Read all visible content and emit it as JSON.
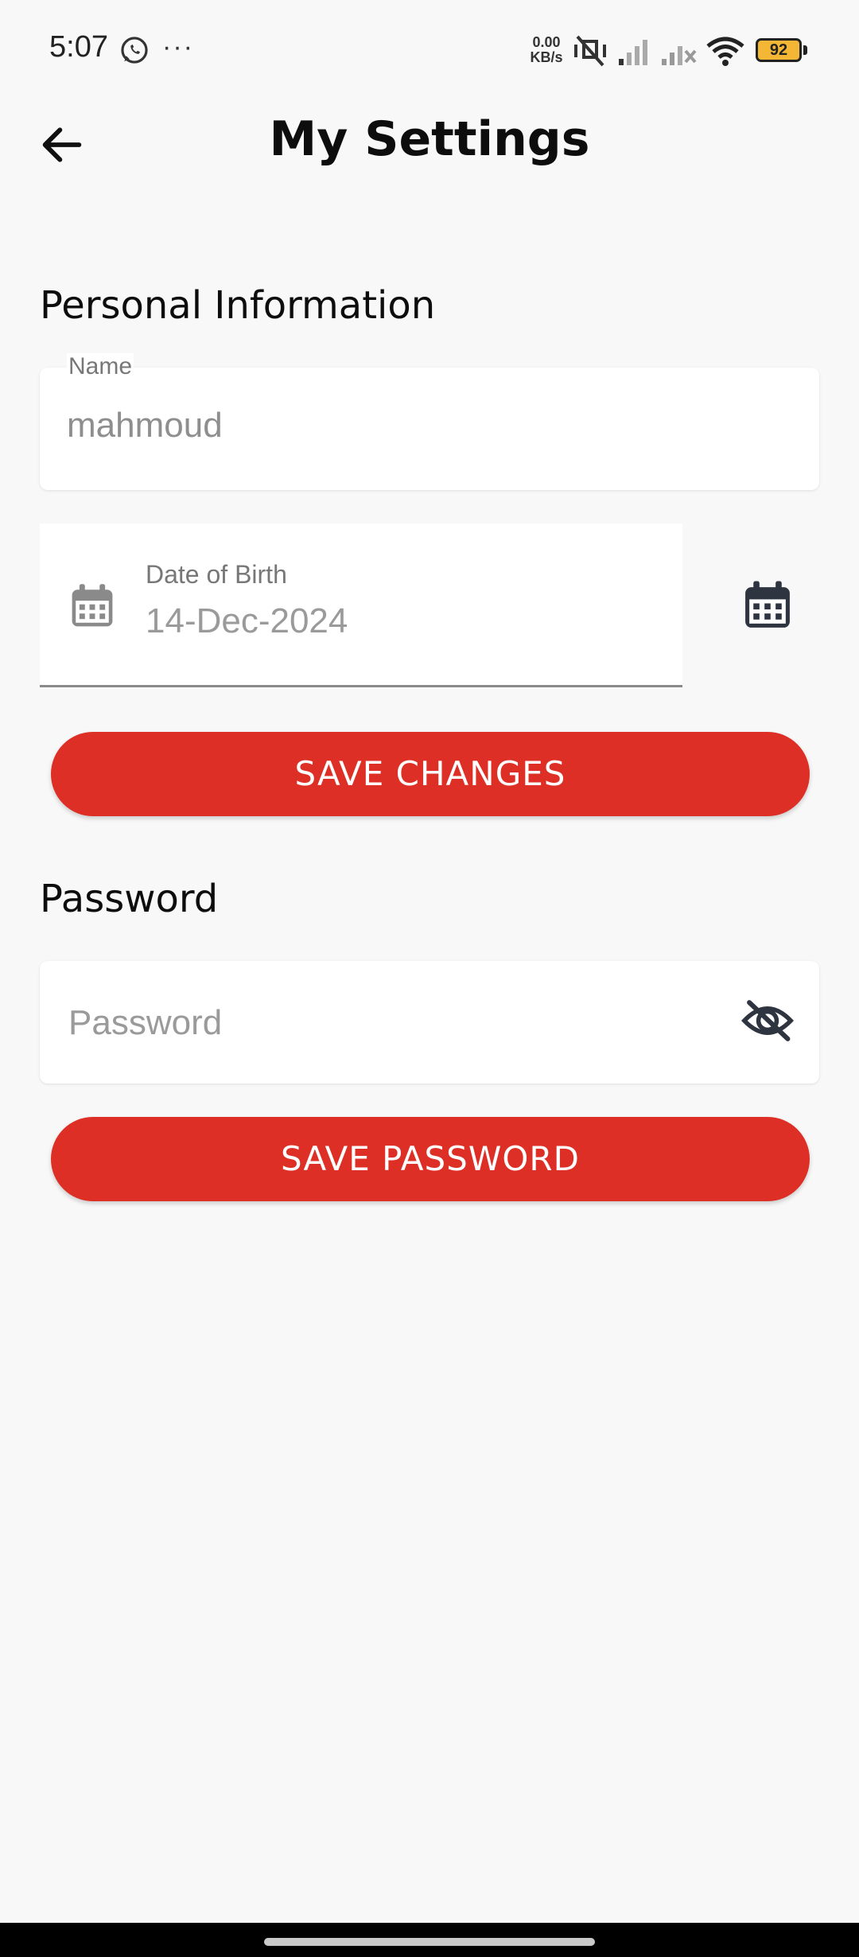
{
  "status_bar": {
    "time": "5:07",
    "more": "···",
    "net_speed_value": "0.00",
    "net_speed_unit": "KB/s",
    "battery_level": "92",
    "icons": [
      "whatsapp-icon",
      "more-icon",
      "mute-icon",
      "signal-icon",
      "signal-x-icon",
      "wifi-icon",
      "battery-icon"
    ]
  },
  "header": {
    "title": "My Settings",
    "back_icon": "arrow-left-icon"
  },
  "personal_info": {
    "section_title": "Personal Information",
    "name_label": "Name",
    "name_value": "mahmoud",
    "dob_label": "Date of Birth",
    "dob_value": "14-Dec-2024",
    "dob_icon": "calendar-icon",
    "dob_picker_icon": "calendar-icon",
    "save_button": "SAVE CHANGES"
  },
  "password_section": {
    "section_title": "Password",
    "placeholder": "Password",
    "value": "",
    "visibility_icon": "eye-off-icon",
    "save_button": "SAVE PASSWORD"
  },
  "colors": {
    "accent": "#dd2f25",
    "background": "#f8f8f8",
    "battery": "#f4b635"
  }
}
